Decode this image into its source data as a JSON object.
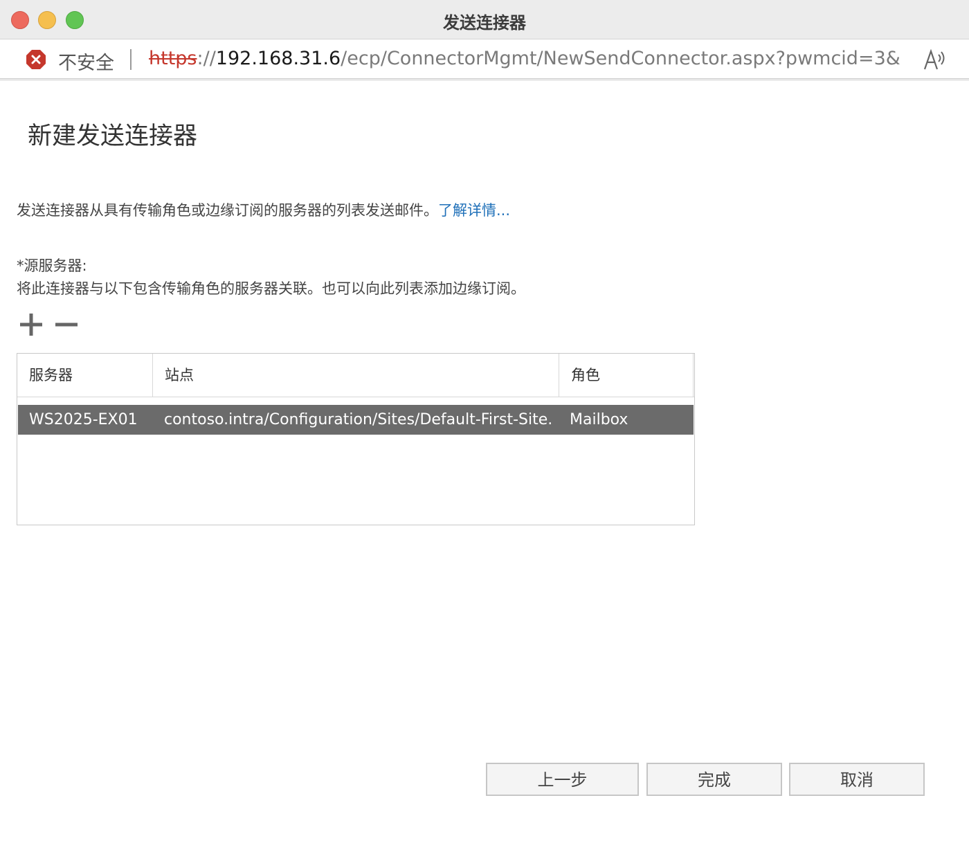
{
  "window": {
    "title": "发送连接器"
  },
  "address_bar": {
    "security_label": "不安全",
    "url_scheme": "https",
    "url_sep": "://",
    "url_host": "192.168.31.6",
    "url_path": "/ecp/ConnectorMgmt/NewSendConnector.aspx?pwmcid=3&..."
  },
  "page": {
    "title": "新建发送连接器",
    "description": "发送连接器从具有传输角色或边缘订阅的服务器的列表发送邮件。",
    "learn_more": "了解详情...",
    "source_label": "*源服务器:",
    "source_help": "将此连接器与以下包含传输角色的服务器关联。也可以向此列表添加边缘订阅。"
  },
  "grid": {
    "columns": [
      "服务器",
      "站点",
      "角色"
    ],
    "rows": [
      {
        "server": "WS2025-EX01",
        "site": "contoso.intra/Configuration/Sites/Default-First-Site...",
        "role": "Mailbox",
        "selected": true
      }
    ]
  },
  "buttons": {
    "back": "上一步",
    "finish": "完成",
    "cancel": "取消"
  },
  "colors": {
    "selected_row": "#6b6b6b",
    "link": "#1e6fb8",
    "insecure": "#c5372c"
  }
}
